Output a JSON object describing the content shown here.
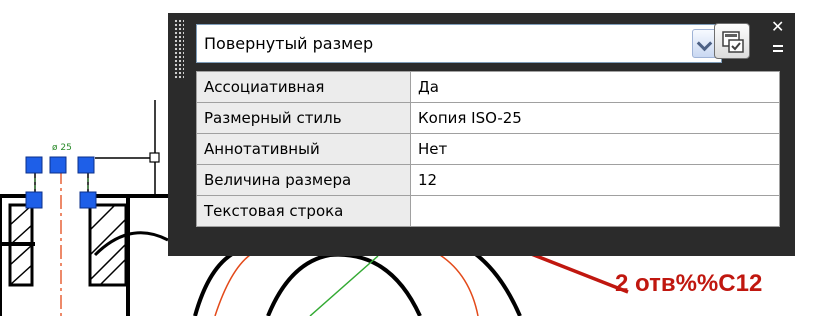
{
  "panel": {
    "title_value": "Повернутый размер",
    "quick_select_icon": "quick-select-icon",
    "close_icon": "close-icon",
    "options_icon": "options-menu-icon"
  },
  "properties": [
    {
      "name": "Ассоциативная",
      "value": "Да"
    },
    {
      "name": "Размерный стиль",
      "value": "Копия ISO-25"
    },
    {
      "name": "Аннотативный",
      "value": "Нет"
    },
    {
      "name": "Величина размера",
      "value": "12"
    },
    {
      "name": "Текстовая строка",
      "value": ""
    }
  ],
  "annotation": {
    "text": "2 отв%%С12",
    "color": "#c0170f"
  },
  "colors": {
    "panel_bg": "#2b2b2b",
    "grip_blue": "#1e5fe8",
    "center_line": "#e34a1a",
    "green_line": "#33aa33"
  }
}
